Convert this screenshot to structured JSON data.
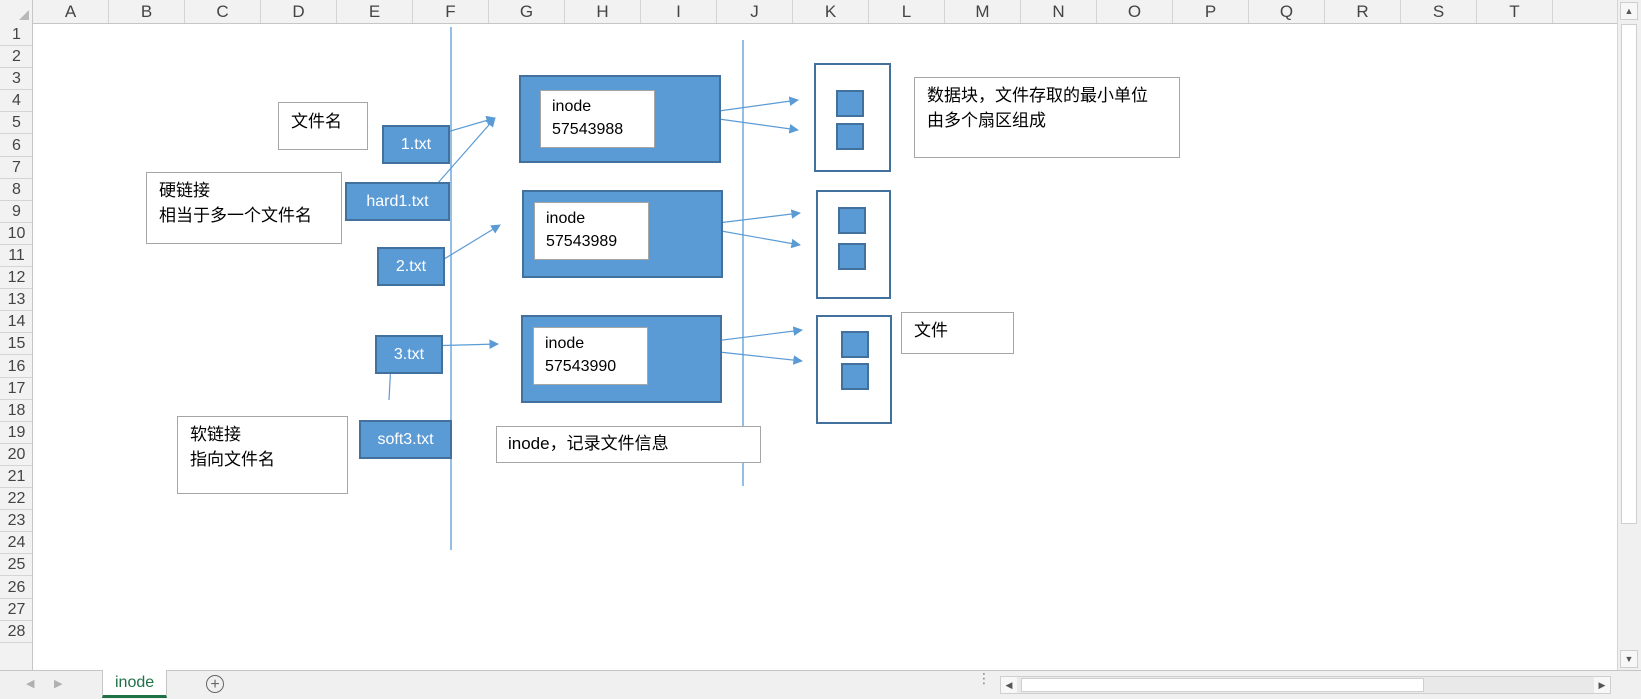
{
  "columns": [
    "A",
    "B",
    "C",
    "D",
    "E",
    "F",
    "G",
    "H",
    "I",
    "J",
    "K",
    "L",
    "M",
    "N",
    "O",
    "P",
    "Q",
    "R",
    "S",
    "T"
  ],
  "rows": [
    "1",
    "2",
    "3",
    "4",
    "5",
    "6",
    "7",
    "8",
    "9",
    "10",
    "11",
    "12",
    "13",
    "14",
    "15",
    "16",
    "17",
    "18",
    "19",
    "20",
    "21",
    "22",
    "23",
    "24",
    "25",
    "26",
    "27",
    "28"
  ],
  "sheet": {
    "active_tab": "inode",
    "add_sheet_symbol": "+"
  },
  "colors": {
    "shape_fill": "#5b9bd5",
    "shape_border": "#41719c",
    "tab_text": "#1e7145"
  },
  "diagram": {
    "label_filename": "文件名",
    "label_hardlink_1": "硬链接",
    "label_hardlink_2": "相当于多一个文件名",
    "label_softlink_1": "软链接",
    "label_softlink_2": "指向文件名",
    "file_1": "1.txt",
    "file_hard1": "hard1.txt",
    "file_2": "2.txt",
    "file_3": "3.txt",
    "file_soft3": "soft3.txt",
    "inode_a_name": "inode",
    "inode_a_num": "57543988",
    "inode_b_name": "inode",
    "inode_b_num": "57543989",
    "inode_c_name": "inode",
    "inode_c_num": "57543990",
    "label_inode_info": "inode，记录文件信息",
    "label_datablock_1": "数据块，文件存取的最小单位",
    "label_datablock_2": "由多个扇区组成",
    "label_file": "文件"
  }
}
